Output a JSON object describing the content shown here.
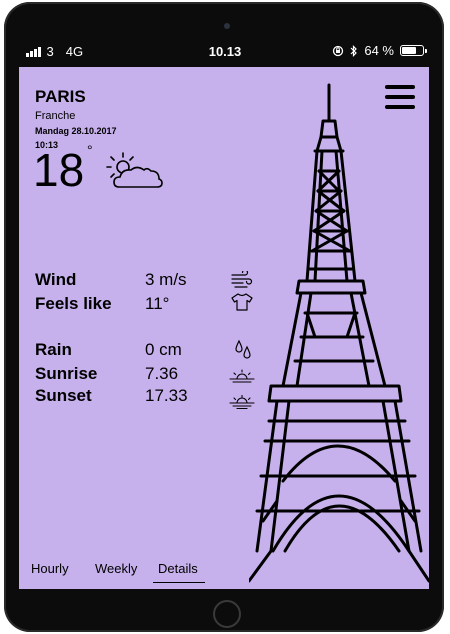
{
  "status_bar": {
    "signal_count": "3",
    "network": "4G",
    "time": "10.13",
    "battery": "64 %"
  },
  "weather": {
    "city": "PARIS",
    "country": "Franche",
    "date": "Mandag 28.10.2017",
    "time": "10:13",
    "temperature": "18",
    "degree_symbol": "°"
  },
  "details": {
    "wind_label": "Wind",
    "wind_value": "3 m/s",
    "feels_like_label": "Feels like",
    "feels_like_value": "11°",
    "rain_label": "Rain",
    "rain_value": "0 cm",
    "sunrise_label": "Sunrise",
    "sunrise_value": "7.36",
    "sunset_label": "Sunset",
    "sunset_value": "17.33"
  },
  "tabs": [
    {
      "label": "Hourly"
    },
    {
      "label": "Weekly"
    },
    {
      "label": "Details"
    }
  ],
  "active_tab": "Details",
  "colors": {
    "screen_bg": "#c7b1ec",
    "frame": "#0c0c0c",
    "ink": "#000000"
  }
}
